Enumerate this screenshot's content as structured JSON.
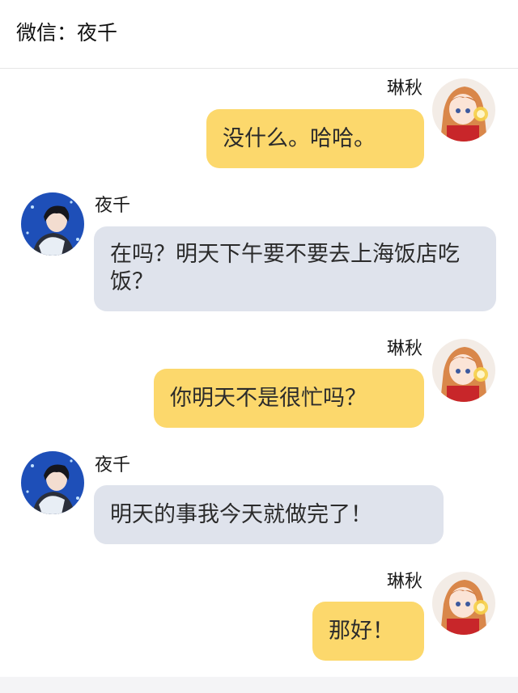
{
  "header": {
    "title": "微信：夜千"
  },
  "users": {
    "me": {
      "name": "琳秋"
    },
    "them": {
      "name": "夜千"
    }
  },
  "messages": [
    {
      "sender": "me",
      "name": "琳秋",
      "text": "没什么。哈哈。"
    },
    {
      "sender": "them",
      "name": "夜千",
      "text": "在吗？明天下午要不要去上海饭店吃饭？"
    },
    {
      "sender": "me",
      "name": "琳秋",
      "text": "你明天不是很忙吗？"
    },
    {
      "sender": "them",
      "name": "夜千",
      "text": "明天的事我今天就做完了！"
    },
    {
      "sender": "me",
      "name": "琳秋",
      "text": "那好！"
    }
  ],
  "colors": {
    "my_bubble": "#fcd86c",
    "their_bubble": "#dfe3ec"
  }
}
